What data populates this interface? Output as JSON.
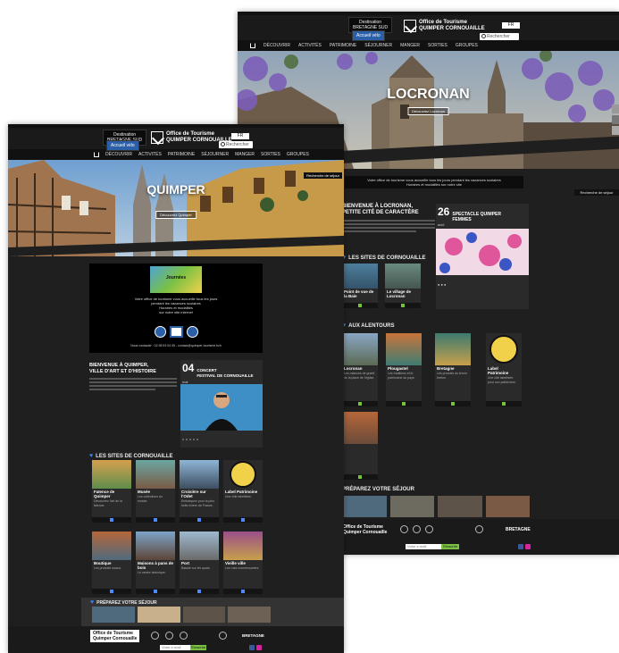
{
  "back": {
    "header": {
      "badge_line1": "Destination",
      "badge_line2": "BRETAGNE SUD",
      "badge_blue": "Accueil vélo",
      "logo_line1": "Office de Tourisme",
      "logo_line2": "QUIMPER CORNOUAILLE",
      "lang": "FR",
      "search_placeholder": "Rechercher"
    },
    "nav": [
      "Découvrir",
      "Activités",
      "Patrimoine",
      "Séjourner",
      "Manger",
      "Sorties",
      "Groupes"
    ],
    "hero": {
      "title": "LOCRONAN",
      "button": "Découvrez Locronan"
    },
    "notice": {
      "line1": "Votre office de tourisme vous accueille tous les jours pendant les vacances scolaires",
      "line2": "Horaires et modalités sur notre site"
    },
    "side_tab": "Recherche de séjour",
    "welcome": {
      "title_line1": "Bienvenue à Locronan,",
      "title_line2": "Petite Cité de Caractère"
    },
    "event": {
      "day": "26",
      "month": "avril",
      "title_line1": "Spectacle Quimper",
      "title_line2": "Femmes"
    },
    "section_visits": "Les sites de Cornouaille",
    "section_around": "Aux alentours",
    "section_bottom": "Préparez votre séjour",
    "cards": [
      {
        "title": "Point de vue de la Baie",
        "text": "Découvrez la vue panoramique sur la baie de Douarnenez."
      },
      {
        "title": "Le village de Locronan",
        "text": "Flânez dans les ruelles pavées de la cité médiévale."
      },
      {
        "title": "Locronan",
        "text": "Les maisons de granit de la place de l'église."
      },
      {
        "title": "Plougastel",
        "text": "Les traditions et le patrimoine du pays."
      },
      {
        "title": "Bretagne",
        "text": "Les produits du terroir breton."
      },
      {
        "title": "Label Patrimoine",
        "text": "Une cité labellisée pour son patrimoine."
      }
    ],
    "footer": {
      "logo_line1": "Office de Tourisme",
      "logo_line2": "Quimper Cornouaille",
      "newsletter_placeholder": "Votre e-mail",
      "newsletter_button": "S'inscrire",
      "brand": "BRETAGNE"
    }
  },
  "front": {
    "header": {
      "badge_line1": "Destination",
      "badge_line2": "BRETAGNE SUD",
      "badge_blue": "Accueil vélo",
      "logo_line1": "Office de Tourisme",
      "logo_line2": "QUIMPER CORNOUAILLE",
      "lang": "FR",
      "search_placeholder": "Rechercher"
    },
    "nav": [
      "Découvrir",
      "Activités",
      "Patrimoine",
      "Séjourner",
      "Manger",
      "Sorties",
      "Groupes"
    ],
    "hero": {
      "title": "QUIMPER",
      "button": "Découvrez Quimper"
    },
    "side_tab": "Recherche de séjour",
    "promo": {
      "image_text": "Journées",
      "lines": [
        "Votre office de tourisme vous accueille tous les jours",
        "pendant les vacances scolaires",
        "Horaires et modalités",
        "sur notre site internet"
      ],
      "footer": "Nous contacter : 02 98 53 04 05 - contact@quimper-tourisme.bzh"
    },
    "welcome": {
      "title_line1": "Bienvenue à Quimper,",
      "title_line2": "Ville d'Art et d'Histoire"
    },
    "event": {
      "day": "04",
      "month": "mai",
      "title_line1": "Concert",
      "title_line2": "Festival de Cornouaille"
    },
    "section_visits": "Les sites de Cornouaille",
    "section_around": "Aux alentours",
    "section_bottom": "Préparez votre séjour",
    "cards": [
      {
        "title": "Faïence de Quimper",
        "text": "Découvrez l'art de la faïence."
      },
      {
        "title": "Musée",
        "text": "Les collections du musée."
      },
      {
        "title": "Croisière sur l'Odet",
        "text": "Embarquez pour la plus belle rivière de France."
      },
      {
        "title": "Label Patrimoine",
        "text": "Une ville labellisée."
      },
      {
        "title": "Boutique",
        "text": "Les produits locaux."
      },
      {
        "title": "Maisons à pans de bois",
        "text": "Le centre historique."
      },
      {
        "title": "Port",
        "text": "Balade sur les quais."
      },
      {
        "title": "Vieille ville",
        "text": "Les rues commerçantes."
      }
    ],
    "footer": {
      "logo_line1": "Office de Tourisme",
      "logo_line2": "Quimper Cornouaille",
      "newsletter_placeholder": "Votre e-mail",
      "newsletter_button": "S'inscrire",
      "brand": "BRETAGNE"
    }
  }
}
